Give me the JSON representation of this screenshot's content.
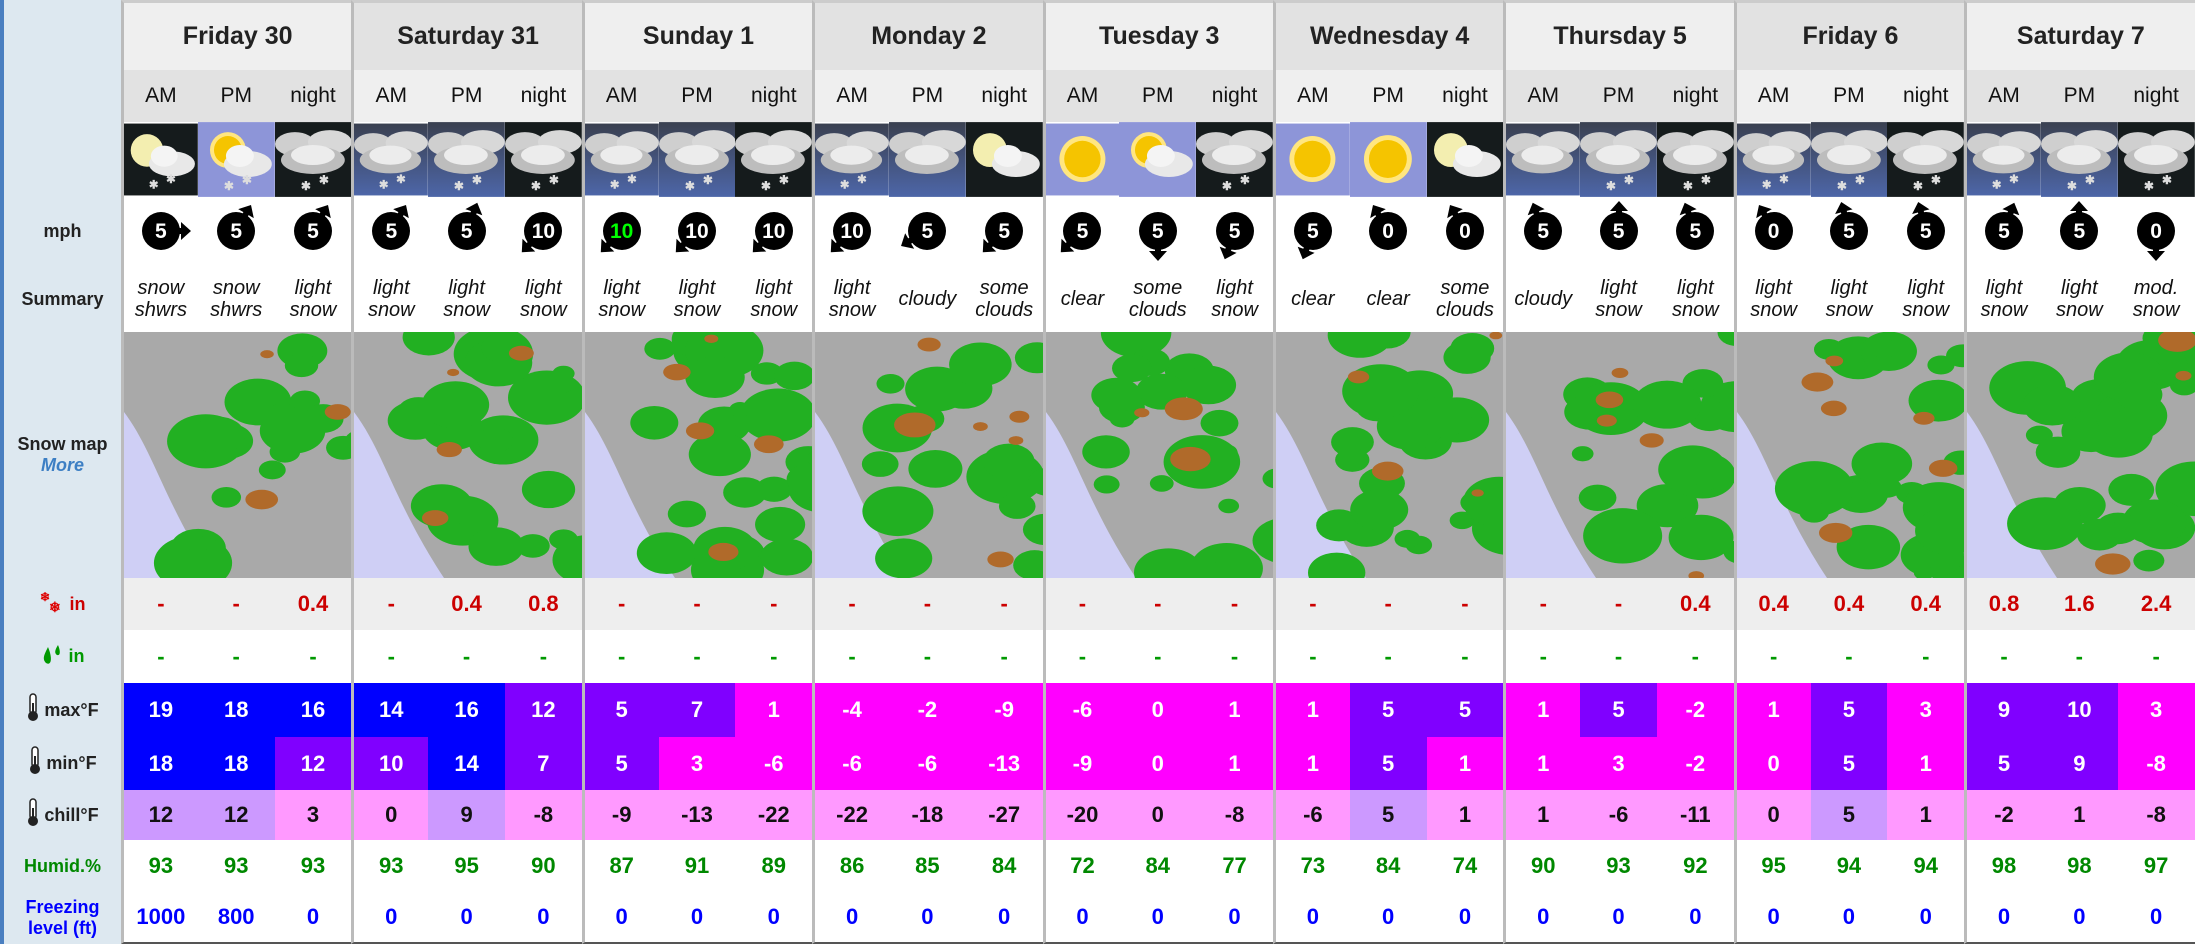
{
  "labels": {
    "wind": "mph",
    "summary": "Summary",
    "snow_map": "Snow map",
    "more": "More",
    "snow": "in",
    "rain": "in",
    "max": "max°F",
    "min": "min°F",
    "chill": "chill°F",
    "humid": "Humid.%",
    "freezing": "Freezing level (ft)"
  },
  "periods": [
    "AM",
    "PM",
    "night"
  ],
  "colors": {
    "cold": "#0000ff",
    "mid": "#8000ff",
    "warm": "#ff00ff",
    "chill_mild": "#cc99ff",
    "chill_cold": "#ff99ff",
    "snow_text": "#cc0000",
    "rain_text": "#009900",
    "humid_text": "#008800",
    "freezing_text": "#0000ff",
    "wind_highlight": "#00ff00"
  },
  "days": [
    {
      "name": "Friday 30",
      "icons": [
        "moon-cloud-snow",
        "sun-cloud-snow",
        "cloud-snow-night"
      ],
      "wind": [
        {
          "v": "5",
          "dir": 90
        },
        {
          "v": "5",
          "dir": 30
        },
        {
          "v": "5",
          "dir": 30
        }
      ],
      "summary": [
        "snow shwrs",
        "snow shwrs",
        "light snow"
      ],
      "snow": [
        "-",
        "-",
        "0.4"
      ],
      "rain": [
        "-",
        "-",
        "-"
      ],
      "max": [
        19,
        18,
        16
      ],
      "min": [
        18,
        18,
        12
      ],
      "chill": [
        12,
        12,
        3
      ],
      "humid": [
        93,
        93,
        93
      ],
      "freezing": [
        1000,
        800,
        0
      ]
    },
    {
      "name": "Saturday 31",
      "icons": [
        "cloud-snow-day",
        "cloud-snow-day",
        "cloud-snow-night"
      ],
      "wind": [
        {
          "v": "5",
          "dir": 30
        },
        {
          "v": "5",
          "dir": 20
        },
        {
          "v": "10",
          "dir": 225
        }
      ],
      "summary": [
        "light snow",
        "light snow",
        "light snow"
      ],
      "snow": [
        "-",
        "0.4",
        "0.8"
      ],
      "rain": [
        "-",
        "-",
        "-"
      ],
      "max": [
        14,
        16,
        12
      ],
      "min": [
        10,
        14,
        7
      ],
      "chill": [
        0,
        9,
        -8
      ],
      "humid": [
        93,
        95,
        90
      ],
      "freezing": [
        0,
        0,
        0
      ]
    },
    {
      "name": "Sunday 1",
      "icons": [
        "cloud-snow-day",
        "cloud-snow-day",
        "cloud-snow-night"
      ],
      "wind": [
        {
          "v": "10",
          "dir": 225,
          "highlight": true
        },
        {
          "v": "10",
          "dir": 225
        },
        {
          "v": "10",
          "dir": 225
        }
      ],
      "summary": [
        "light snow",
        "light snow",
        "light snow"
      ],
      "snow": [
        "-",
        "-",
        "-"
      ],
      "rain": [
        "-",
        "-",
        "-"
      ],
      "max": [
        5,
        7,
        1
      ],
      "min": [
        5,
        3,
        -6
      ],
      "chill": [
        -9,
        -13,
        -22
      ],
      "humid": [
        87,
        91,
        89
      ],
      "freezing": [
        0,
        0,
        0
      ]
    },
    {
      "name": "Monday 2",
      "icons": [
        "cloud-snow-day",
        "cloud-day",
        "moon-cloud"
      ],
      "wind": [
        {
          "v": "10",
          "dir": 225
        },
        {
          "v": "5",
          "dir": 240
        },
        {
          "v": "5",
          "dir": 225
        }
      ],
      "summary": [
        "light snow",
        "cloudy",
        "some clouds"
      ],
      "snow": [
        "-",
        "-",
        "-"
      ],
      "rain": [
        "-",
        "-",
        "-"
      ],
      "max": [
        -4,
        -2,
        -9
      ],
      "min": [
        -6,
        -6,
        -13
      ],
      "chill": [
        -22,
        -18,
        -27
      ],
      "humid": [
        86,
        85,
        84
      ],
      "freezing": [
        0,
        0,
        0
      ]
    },
    {
      "name": "Tuesday 3",
      "icons": [
        "sun",
        "sun-cloud",
        "cloud-snow-night"
      ],
      "wind": [
        {
          "v": "5",
          "dir": 225
        },
        {
          "v": "5",
          "dir": 180
        },
        {
          "v": "5",
          "dir": 200
        }
      ],
      "summary": [
        "clear",
        "some clouds",
        "light snow"
      ],
      "snow": [
        "-",
        "-",
        "-"
      ],
      "rain": [
        "-",
        "-",
        "-"
      ],
      "max": [
        -6,
        0,
        1
      ],
      "min": [
        -9,
        0,
        1
      ],
      "chill": [
        -20,
        0,
        -8
      ],
      "humid": [
        72,
        84,
        77
      ],
      "freezing": [
        0,
        0,
        0
      ]
    },
    {
      "name": "Wednesday 4",
      "icons": [
        "sun",
        "sun",
        "moon-cloud"
      ],
      "wind": [
        {
          "v": "5",
          "dir": 200
        },
        {
          "v": "0",
          "dir": 330
        },
        {
          "v": "0",
          "dir": 330
        }
      ],
      "summary": [
        "clear",
        "clear",
        "some clouds"
      ],
      "snow": [
        "-",
        "-",
        "-"
      ],
      "rain": [
        "-",
        "-",
        "-"
      ],
      "max": [
        1,
        5,
        5
      ],
      "min": [
        1,
        5,
        1
      ],
      "chill": [
        -6,
        5,
        1
      ],
      "humid": [
        73,
        84,
        74
      ],
      "freezing": [
        0,
        0,
        0
      ]
    },
    {
      "name": "Thursday 5",
      "icons": [
        "cloud-day",
        "cloud-snow-day",
        "cloud-snow-night"
      ],
      "wind": [
        {
          "v": "5",
          "dir": 340
        },
        {
          "v": "5",
          "dir": 0
        },
        {
          "v": "5",
          "dir": 340
        }
      ],
      "summary": [
        "cloudy",
        "light snow",
        "light snow"
      ],
      "snow": [
        "-",
        "-",
        "0.4"
      ],
      "rain": [
        "-",
        "-",
        "-"
      ],
      "max": [
        1,
        5,
        -2
      ],
      "min": [
        1,
        3,
        -2
      ],
      "chill": [
        1,
        -6,
        -11
      ],
      "humid": [
        90,
        93,
        92
      ],
      "freezing": [
        0,
        0,
        0
      ]
    },
    {
      "name": "Friday 6",
      "icons": [
        "cloud-snow-day",
        "cloud-snow-day",
        "cloud-snow-night"
      ],
      "wind": [
        {
          "v": "0",
          "dir": 330
        },
        {
          "v": "5",
          "dir": 345
        },
        {
          "v": "5",
          "dir": 345
        }
      ],
      "summary": [
        "light snow",
        "light snow",
        "light snow"
      ],
      "snow": [
        "0.4",
        "0.4",
        "0.4"
      ],
      "rain": [
        "-",
        "-",
        "-"
      ],
      "max": [
        1,
        5,
        3
      ],
      "min": [
        0,
        5,
        1
      ],
      "chill": [
        0,
        5,
        1
      ],
      "humid": [
        95,
        94,
        94
      ],
      "freezing": [
        0,
        0,
        0
      ]
    },
    {
      "name": "Saturday 7",
      "icons": [
        "cloud-snow-day",
        "cloud-snow-day",
        "cloud-snow-night"
      ],
      "wind": [
        {
          "v": "5",
          "dir": 20
        },
        {
          "v": "5",
          "dir": 0
        },
        {
          "v": "0",
          "dir": 180
        }
      ],
      "summary": [
        "light snow",
        "light snow",
        "mod. snow"
      ],
      "snow": [
        "0.8",
        "1.6",
        "2.4"
      ],
      "rain": [
        "-",
        "-",
        "-"
      ],
      "max": [
        9,
        10,
        3
      ],
      "min": [
        5,
        9,
        -8
      ],
      "chill": [
        -2,
        1,
        -8
      ],
      "humid": [
        98,
        98,
        97
      ],
      "freezing": [
        0,
        0,
        0
      ]
    }
  ]
}
